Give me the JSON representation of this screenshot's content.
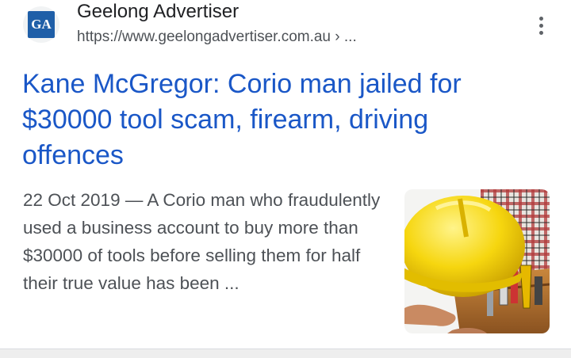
{
  "result": {
    "favicon_text": "GA",
    "site_name": "Geelong Advertiser",
    "url": "https://www.geelongadvertiser.com.au",
    "url_suffix": " › ...",
    "title": "Kane McGregor: Corio man jailed for $30000 tool scam, firearm, driving offences",
    "date": "22 Oct 2019",
    "separator": " — ",
    "snippet": "A Corio man who fraudulently used a business account to buy more than $30000 of tools before selling them for half their true value has been ...",
    "more_icon": "more-vert-icon",
    "thumbnail_icon": "hard-hat-tools-thumbnail"
  },
  "colors": {
    "title_link": "#1a57c7",
    "site_name": "#202124",
    "url_text": "#4d5156",
    "snippet_text": "#4d5156",
    "favicon_bg": "#1f5fa8"
  }
}
